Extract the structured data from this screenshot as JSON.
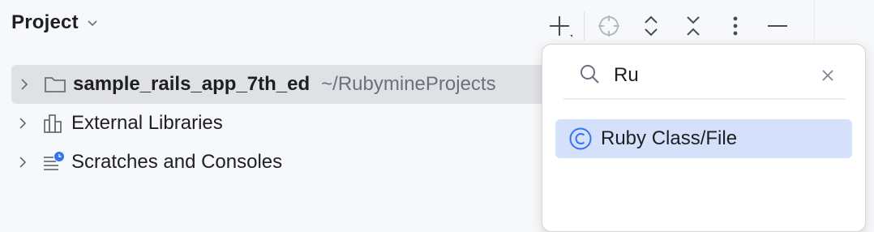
{
  "header": {
    "title": "Project",
    "title_dropdown_icon": "chevron-down-icon",
    "toolbar": [
      {
        "name": "add-icon"
      },
      {
        "name": "locate-icon"
      },
      {
        "name": "expand-all-icon"
      },
      {
        "name": "collapse-all-icon"
      },
      {
        "name": "more-options-icon"
      },
      {
        "name": "minimize-icon"
      }
    ]
  },
  "tree": {
    "items": [
      {
        "label": "sample_rails_app_7th_ed",
        "path": "~/RubymineProjects",
        "icon": "folder-icon",
        "selected": true
      },
      {
        "label": "External Libraries",
        "icon": "libraries-icon"
      },
      {
        "label": "Scratches and Consoles",
        "icon": "scratches-icon"
      }
    ]
  },
  "popup": {
    "search_value": "Ru",
    "options": [
      {
        "label": "Ruby Class/File",
        "icon": "ruby-class-icon"
      }
    ]
  },
  "colors": {
    "background": "#f7f8fa",
    "selected_row": "#dfe1e5",
    "option_highlight": "#d5e1fb",
    "accent_blue": "#3574f0",
    "muted_text": "#6c707e"
  }
}
